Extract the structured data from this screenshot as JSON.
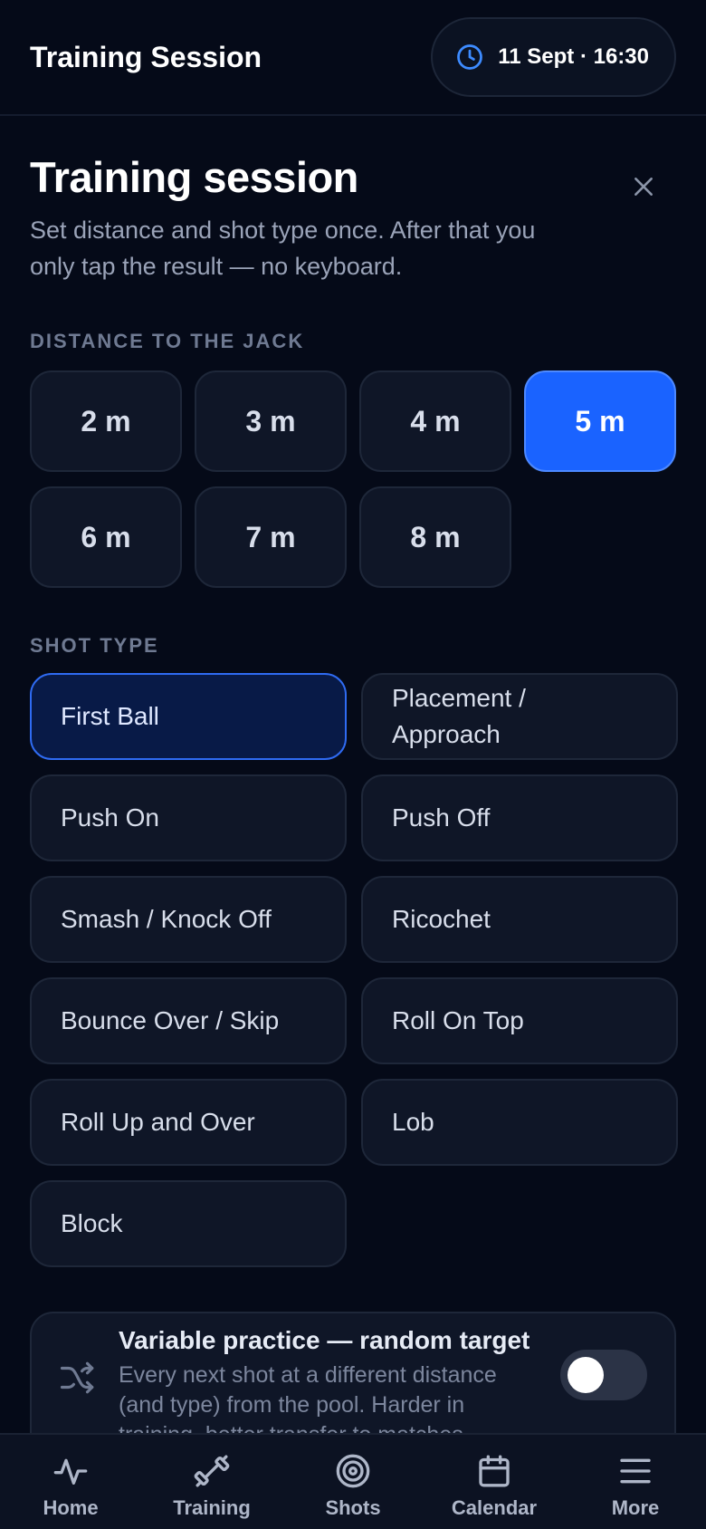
{
  "header": {
    "title": "Training Session",
    "datetime": "11 Sept · 16:30"
  },
  "page": {
    "title": "Training session",
    "subtitle": "Set distance and shot type once. After that you only tap the result — no keyboard."
  },
  "distance": {
    "label": "DISTANCE TO THE JACK",
    "options": [
      "2 m",
      "3 m",
      "4 m",
      "5 m",
      "6 m",
      "7 m",
      "8 m"
    ],
    "selected": "5 m"
  },
  "shot_type": {
    "label": "SHOT TYPE",
    "options": [
      "First Ball",
      "Placement / Approach",
      "Push On",
      "Push Off",
      "Smash / Knock Off",
      "Ricochet",
      "Bounce Over / Skip",
      "Roll On Top",
      "Roll Up and Over",
      "Lob",
      "Block"
    ],
    "selected": "First Ball"
  },
  "variable_practice": {
    "title": "Variable practice — random target",
    "description": "Every next shot at a different distance (and type) from the pool. Harder in training, better transfer to matches.",
    "enabled": false,
    "icon": "shuffle-icon"
  },
  "nav": {
    "items": [
      {
        "label": "Home",
        "icon": "activity-icon"
      },
      {
        "label": "Training",
        "icon": "dumbbell-icon"
      },
      {
        "label": "Shots",
        "icon": "target-icon"
      },
      {
        "label": "Calendar",
        "icon": "calendar-icon"
      },
      {
        "label": "More",
        "icon": "menu-icon"
      }
    ]
  },
  "colors": {
    "background": "#050a18",
    "accent": "#1a63ff",
    "selected_shot": "#081a47"
  }
}
